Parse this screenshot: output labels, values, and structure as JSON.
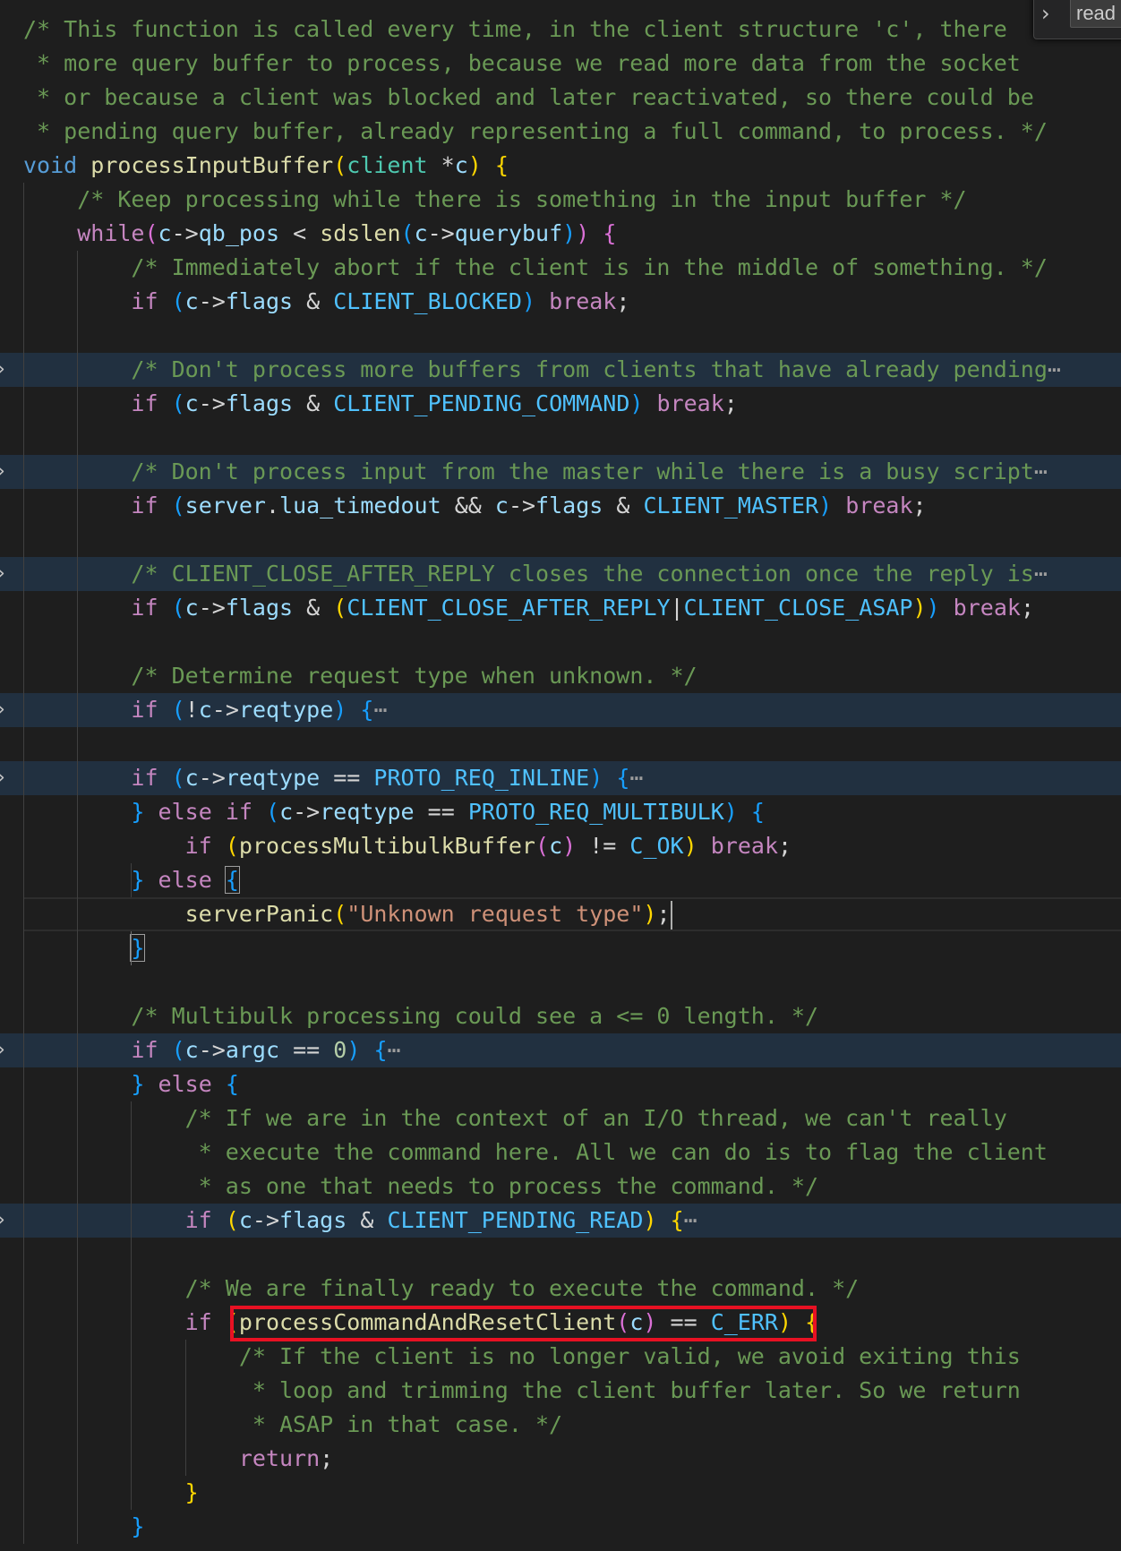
{
  "find_widget": {
    "query": "read"
  },
  "editor": {
    "lines": [
      {
        "tokens": [
          [
            "cm",
            "/* This function is called every time, in the client structure 'c', there"
          ]
        ]
      },
      {
        "tokens": [
          [
            "cm",
            " * more query buffer to process, because we read more data from the socket"
          ]
        ]
      },
      {
        "tokens": [
          [
            "cm",
            " * or because a client was blocked and later reactivated, so there could be"
          ]
        ]
      },
      {
        "tokens": [
          [
            "cm",
            " * pending query buffer, already representing a full command, to process. */"
          ]
        ]
      },
      {
        "tokens": [
          [
            "kw",
            "void"
          ],
          [
            "op",
            " "
          ],
          [
            "fn",
            "processInputBuffer"
          ],
          [
            "p1",
            "("
          ],
          [
            "ty",
            "client"
          ],
          [
            "op",
            " *"
          ],
          [
            "var",
            "c"
          ],
          [
            "p1",
            ")"
          ],
          [
            "op",
            " "
          ],
          [
            "p1",
            "{"
          ]
        ]
      },
      {
        "tokens": [
          [
            "op",
            "    "
          ],
          [
            "cm",
            "/* Keep processing while there is something in the input buffer */"
          ]
        ]
      },
      {
        "tokens": [
          [
            "op",
            "    "
          ],
          [
            "ctl",
            "while"
          ],
          [
            "p2",
            "("
          ],
          [
            "var",
            "c"
          ],
          [
            "op",
            "->"
          ],
          [
            "var",
            "qb_pos"
          ],
          [
            "op",
            " < "
          ],
          [
            "fn",
            "sdslen"
          ],
          [
            "p3",
            "("
          ],
          [
            "var",
            "c"
          ],
          [
            "op",
            "->"
          ],
          [
            "var",
            "querybuf"
          ],
          [
            "p3",
            ")"
          ],
          [
            "p2",
            ")"
          ],
          [
            "op",
            " "
          ],
          [
            "p2",
            "{"
          ]
        ]
      },
      {
        "tokens": [
          [
            "op",
            "        "
          ],
          [
            "cm",
            "/* Immediately abort if the client is in the middle of something. */"
          ]
        ]
      },
      {
        "tokens": [
          [
            "op",
            "        "
          ],
          [
            "ctl",
            "if"
          ],
          [
            "op",
            " "
          ],
          [
            "p3",
            "("
          ],
          [
            "var",
            "c"
          ],
          [
            "op",
            "->"
          ],
          [
            "var",
            "flags"
          ],
          [
            "op",
            " & "
          ],
          [
            "const",
            "CLIENT_BLOCKED"
          ],
          [
            "p3",
            ")"
          ],
          [
            "op",
            " "
          ],
          [
            "ctl",
            "break"
          ],
          [
            "op",
            ";"
          ]
        ]
      },
      {
        "tokens": []
      },
      {
        "folded": true,
        "tokens": [
          [
            "op",
            "        "
          ],
          [
            "cm",
            "/* Don't process more buffers from clients that have already pending"
          ],
          [
            "ell",
            "⋯"
          ]
        ]
      },
      {
        "tokens": [
          [
            "op",
            "        "
          ],
          [
            "ctl",
            "if"
          ],
          [
            "op",
            " "
          ],
          [
            "p3",
            "("
          ],
          [
            "var",
            "c"
          ],
          [
            "op",
            "->"
          ],
          [
            "var",
            "flags"
          ],
          [
            "op",
            " & "
          ],
          [
            "const",
            "CLIENT_PENDING_COMMAND"
          ],
          [
            "p3",
            ")"
          ],
          [
            "op",
            " "
          ],
          [
            "ctl",
            "break"
          ],
          [
            "op",
            ";"
          ]
        ]
      },
      {
        "tokens": []
      },
      {
        "folded": true,
        "tokens": [
          [
            "op",
            "        "
          ],
          [
            "cm",
            "/* Don't process input from the master while there is a busy script"
          ],
          [
            "ell",
            "⋯"
          ]
        ]
      },
      {
        "tokens": [
          [
            "op",
            "        "
          ],
          [
            "ctl",
            "if"
          ],
          [
            "op",
            " "
          ],
          [
            "p3",
            "("
          ],
          [
            "var",
            "server"
          ],
          [
            "op",
            "."
          ],
          [
            "var",
            "lua_timedout"
          ],
          [
            "op",
            " && "
          ],
          [
            "var",
            "c"
          ],
          [
            "op",
            "->"
          ],
          [
            "var",
            "flags"
          ],
          [
            "op",
            " & "
          ],
          [
            "const",
            "CLIENT_MASTER"
          ],
          [
            "p3",
            ")"
          ],
          [
            "op",
            " "
          ],
          [
            "ctl",
            "break"
          ],
          [
            "op",
            ";"
          ]
        ]
      },
      {
        "tokens": []
      },
      {
        "folded": true,
        "tokens": [
          [
            "op",
            "        "
          ],
          [
            "cm",
            "/* CLIENT_CLOSE_AFTER_REPLY closes the connection once the reply is"
          ],
          [
            "ell",
            "⋯"
          ]
        ]
      },
      {
        "tokens": [
          [
            "op",
            "        "
          ],
          [
            "ctl",
            "if"
          ],
          [
            "op",
            " "
          ],
          [
            "p3",
            "("
          ],
          [
            "var",
            "c"
          ],
          [
            "op",
            "->"
          ],
          [
            "var",
            "flags"
          ],
          [
            "op",
            " & "
          ],
          [
            "p1",
            "("
          ],
          [
            "const",
            "CLIENT_CLOSE_AFTER_REPLY"
          ],
          [
            "op",
            "|"
          ],
          [
            "const",
            "CLIENT_CLOSE_ASAP"
          ],
          [
            "p1",
            ")"
          ],
          [
            "p3",
            ")"
          ],
          [
            "op",
            " "
          ],
          [
            "ctl",
            "break"
          ],
          [
            "op",
            ";"
          ]
        ]
      },
      {
        "tokens": []
      },
      {
        "tokens": [
          [
            "op",
            "        "
          ],
          [
            "cm",
            "/* Determine request type when unknown. */"
          ]
        ]
      },
      {
        "folded": true,
        "tokens": [
          [
            "op",
            "        "
          ],
          [
            "ctl",
            "if"
          ],
          [
            "op",
            " "
          ],
          [
            "p3",
            "("
          ],
          [
            "op",
            "!"
          ],
          [
            "var",
            "c"
          ],
          [
            "op",
            "->"
          ],
          [
            "var",
            "reqtype"
          ],
          [
            "p3",
            ")"
          ],
          [
            "op",
            " "
          ],
          [
            "p3",
            "{"
          ],
          [
            "ell",
            "⋯"
          ]
        ]
      },
      {
        "tokens": []
      },
      {
        "folded": true,
        "tokens": [
          [
            "op",
            "        "
          ],
          [
            "ctl",
            "if"
          ],
          [
            "op",
            " "
          ],
          [
            "p3",
            "("
          ],
          [
            "var",
            "c"
          ],
          [
            "op",
            "->"
          ],
          [
            "var",
            "reqtype"
          ],
          [
            "op",
            " == "
          ],
          [
            "const",
            "PROTO_REQ_INLINE"
          ],
          [
            "p3",
            ")"
          ],
          [
            "op",
            " "
          ],
          [
            "p3",
            "{"
          ],
          [
            "ell",
            "⋯"
          ]
        ]
      },
      {
        "tokens": [
          [
            "op",
            "        "
          ],
          [
            "p3",
            "}"
          ],
          [
            "op",
            " "
          ],
          [
            "ctl",
            "else"
          ],
          [
            "op",
            " "
          ],
          [
            "ctl",
            "if"
          ],
          [
            "op",
            " "
          ],
          [
            "p3",
            "("
          ],
          [
            "var",
            "c"
          ],
          [
            "op",
            "->"
          ],
          [
            "var",
            "reqtype"
          ],
          [
            "op",
            " == "
          ],
          [
            "const",
            "PROTO_REQ_MULTIBULK"
          ],
          [
            "p3",
            ")"
          ],
          [
            "op",
            " "
          ],
          [
            "p3",
            "{"
          ]
        ]
      },
      {
        "tokens": [
          [
            "op",
            "            "
          ],
          [
            "ctl",
            "if"
          ],
          [
            "op",
            " "
          ],
          [
            "p1",
            "("
          ],
          [
            "fn",
            "processMultibulkBuffer"
          ],
          [
            "p2",
            "("
          ],
          [
            "var",
            "c"
          ],
          [
            "p2",
            ")"
          ],
          [
            "op",
            " != "
          ],
          [
            "const",
            "C_OK"
          ],
          [
            "p1",
            ")"
          ],
          [
            "op",
            " "
          ],
          [
            "ctl",
            "break"
          ],
          [
            "op",
            ";"
          ]
        ]
      },
      {
        "tokens": [
          [
            "op",
            "        "
          ],
          [
            "p3",
            "}"
          ],
          [
            "op",
            " "
          ],
          [
            "ctl",
            "else"
          ],
          [
            "op",
            " "
          ],
          [
            "p3bm",
            "{"
          ]
        ]
      },
      {
        "cursor": true,
        "tokens": [
          [
            "op",
            "            "
          ],
          [
            "fn",
            "serverPanic"
          ],
          [
            "p1",
            "("
          ],
          [
            "str",
            "\"Unknown request type\""
          ],
          [
            "p1",
            ")"
          ],
          [
            "op",
            ";"
          ],
          [
            "caret",
            ""
          ]
        ]
      },
      {
        "tokens": [
          [
            "op",
            "        "
          ],
          [
            "p3bm",
            "}"
          ]
        ]
      },
      {
        "tokens": []
      },
      {
        "tokens": [
          [
            "op",
            "        "
          ],
          [
            "cm",
            "/* Multibulk processing could see a <= 0 length. */"
          ]
        ]
      },
      {
        "folded": true,
        "tokens": [
          [
            "op",
            "        "
          ],
          [
            "ctl",
            "if"
          ],
          [
            "op",
            " "
          ],
          [
            "p3",
            "("
          ],
          [
            "var",
            "c"
          ],
          [
            "op",
            "->"
          ],
          [
            "var",
            "argc"
          ],
          [
            "op",
            " == "
          ],
          [
            "num",
            "0"
          ],
          [
            "p3",
            ")"
          ],
          [
            "op",
            " "
          ],
          [
            "p3",
            "{"
          ],
          [
            "ell",
            "⋯"
          ]
        ]
      },
      {
        "tokens": [
          [
            "op",
            "        "
          ],
          [
            "p3",
            "}"
          ],
          [
            "op",
            " "
          ],
          [
            "ctl",
            "else"
          ],
          [
            "op",
            " "
          ],
          [
            "p3",
            "{"
          ]
        ]
      },
      {
        "tokens": [
          [
            "op",
            "            "
          ],
          [
            "cm",
            "/* If we are in the context of an I/O thread, we can't really"
          ]
        ]
      },
      {
        "tokens": [
          [
            "op",
            "             "
          ],
          [
            "cm",
            "* execute the command here. All we can do is to flag the client"
          ]
        ]
      },
      {
        "tokens": [
          [
            "op",
            "             "
          ],
          [
            "cm",
            "* as one that needs to process the command. */"
          ]
        ]
      },
      {
        "folded": true,
        "tokens": [
          [
            "op",
            "            "
          ],
          [
            "ctl",
            "if"
          ],
          [
            "op",
            " "
          ],
          [
            "p1",
            "("
          ],
          [
            "var",
            "c"
          ],
          [
            "op",
            "->"
          ],
          [
            "var",
            "flags"
          ],
          [
            "op",
            " & "
          ],
          [
            "const",
            "CLIENT_PENDING_READ"
          ],
          [
            "p1",
            ")"
          ],
          [
            "op",
            " "
          ],
          [
            "p1",
            "{"
          ],
          [
            "ell",
            "⋯"
          ]
        ]
      },
      {
        "tokens": []
      },
      {
        "tokens": [
          [
            "op",
            "            "
          ],
          [
            "cm",
            "/* We are finally ready to execute the command. */"
          ]
        ]
      },
      {
        "tokens": [
          [
            "op",
            "            "
          ],
          [
            "ctl",
            "if"
          ],
          [
            "op",
            " "
          ],
          [
            "p1",
            "("
          ],
          [
            "fn",
            "processCommandAndResetClient"
          ],
          [
            "p2",
            "("
          ],
          [
            "var",
            "c"
          ],
          [
            "p2",
            ")"
          ],
          [
            "op",
            " == "
          ],
          [
            "const",
            "C_ERR"
          ],
          [
            "p1",
            ")"
          ],
          [
            "op",
            " "
          ],
          [
            "p1",
            "{"
          ]
        ]
      },
      {
        "tokens": [
          [
            "op",
            "                "
          ],
          [
            "cm",
            "/* If the client is no longer valid, we avoid exiting this"
          ]
        ]
      },
      {
        "tokens": [
          [
            "op",
            "                 "
          ],
          [
            "cm",
            "* loop and trimming the client buffer later. So we return"
          ]
        ]
      },
      {
        "tokens": [
          [
            "op",
            "                 "
          ],
          [
            "cm",
            "* ASAP in that case. */"
          ]
        ]
      },
      {
        "tokens": [
          [
            "op",
            "                "
          ],
          [
            "ctl",
            "return"
          ],
          [
            "op",
            ";"
          ]
        ]
      },
      {
        "tokens": [
          [
            "op",
            "            "
          ],
          [
            "p1",
            "}"
          ]
        ]
      },
      {
        "tokens": [
          [
            "op",
            "        "
          ],
          [
            "p3",
            "}"
          ]
        ]
      }
    ]
  }
}
